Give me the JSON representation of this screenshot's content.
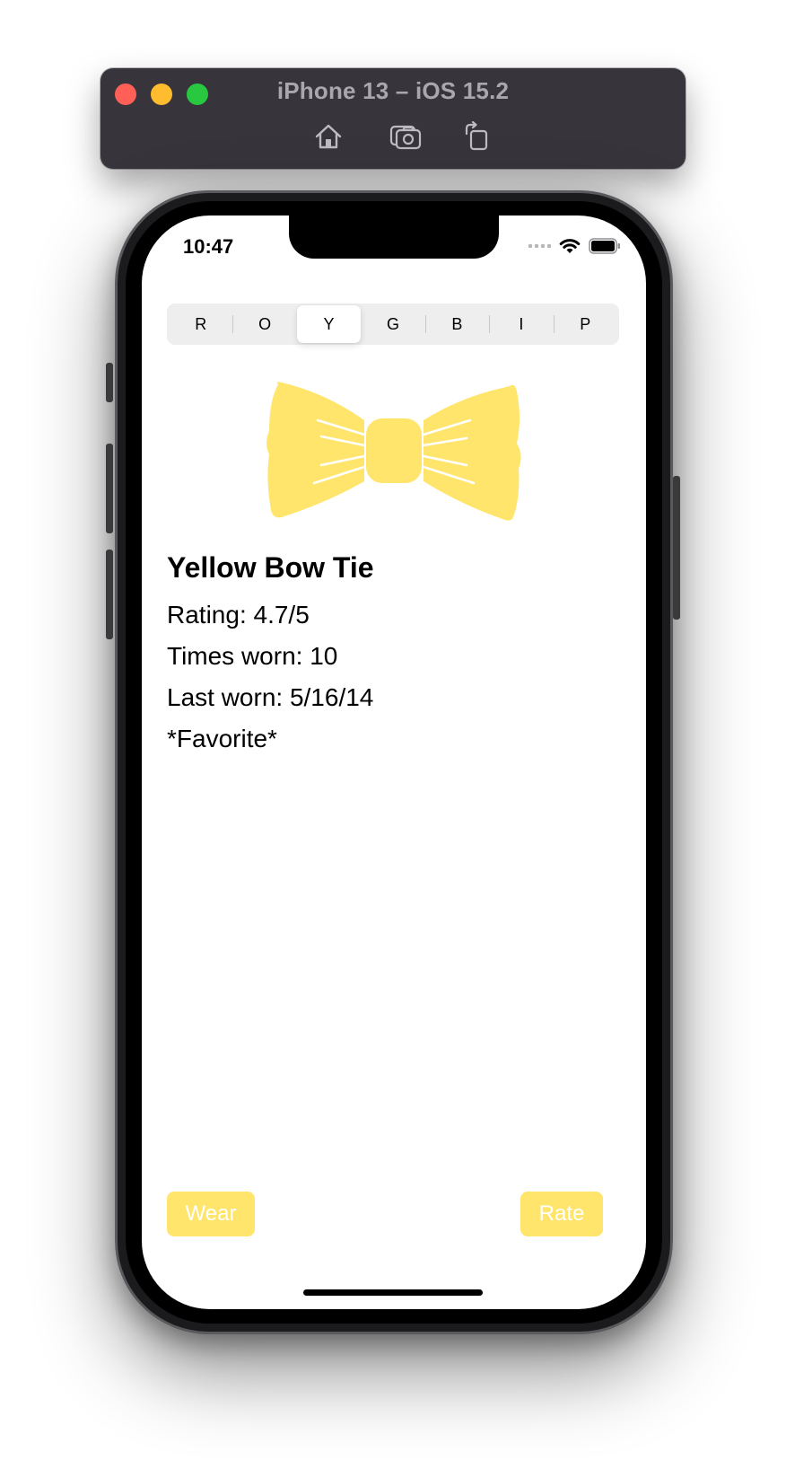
{
  "simulator": {
    "title": "iPhone 13 – iOS 15.2",
    "toolbar": [
      "home-icon",
      "screenshot-icon",
      "rotate-icon"
    ]
  },
  "status_bar": {
    "time": "10:47",
    "icons": [
      "cellular-signal-icon",
      "wifi-icon",
      "battery-icon"
    ]
  },
  "color_picker": {
    "segments": [
      "R",
      "O",
      "Y",
      "G",
      "B",
      "I",
      "P"
    ],
    "selected": "Y"
  },
  "bow_tie": {
    "icon": "bow-tie-icon",
    "color": "#ffe56b"
  },
  "details": {
    "name": "Yellow Bow Tie",
    "rating": "Rating: 4.7/5",
    "times_worn": "Times worn: 10",
    "last_worn": "Last worn: 5/16/14",
    "favorite": "*Favorite*"
  },
  "actions": {
    "wear_label": "Wear",
    "rate_label": "Rate",
    "button_color": "#ffe56b"
  }
}
